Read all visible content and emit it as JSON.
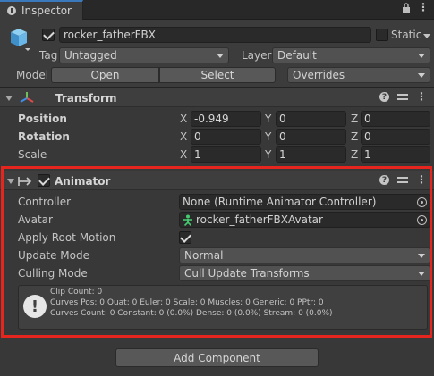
{
  "tab": {
    "title": "Inspector",
    "icons": [
      "lock-icon",
      "kebab-icon"
    ]
  },
  "object": {
    "name": "rocker_fatherFBX",
    "active": true,
    "static_label": "Static",
    "tag_label": "Tag",
    "tag_value": "Untagged",
    "layer_label": "Layer",
    "layer_value": "Default",
    "model_label": "Model",
    "open_label": "Open",
    "select_label": "Select",
    "overrides_label": "Overrides"
  },
  "transform": {
    "title": "Transform",
    "rows": [
      {
        "label": "Position",
        "x": "-0.949",
        "y": "0",
        "z": "0"
      },
      {
        "label": "Rotation",
        "x": "0",
        "y": "0",
        "z": "0"
      },
      {
        "label": "Scale",
        "x": "1",
        "y": "1",
        "z": "1"
      }
    ],
    "axis_x": "X",
    "axis_y": "Y",
    "axis_z": "Z"
  },
  "animator": {
    "title": "Animator",
    "enabled": true,
    "controller_label": "Controller",
    "controller_value": "None (Runtime Animator Controller)",
    "avatar_label": "Avatar",
    "avatar_value": "rocker_fatherFBXAvatar",
    "apply_root_motion_label": "Apply Root Motion",
    "apply_root_motion": true,
    "update_mode_label": "Update Mode",
    "update_mode_value": "Normal",
    "culling_mode_label": "Culling Mode",
    "culling_mode_value": "Cull Update Transforms",
    "info": {
      "line1": "Clip Count: 0",
      "line2": "Curves Pos: 0 Quat: 0 Euler: 0 Scale: 0 Muscles: 0 Generic: 0 PPtr: 0",
      "line3": "Curves Count: 0 Constant: 0 (0.0%) Dense: 0 (0.0%) Stream: 0 (0.0%)"
    }
  },
  "add_component_label": "Add Component",
  "colors": {
    "highlight": "#e6251f",
    "background": "#383838",
    "tab_accent": "#3a79bb"
  }
}
